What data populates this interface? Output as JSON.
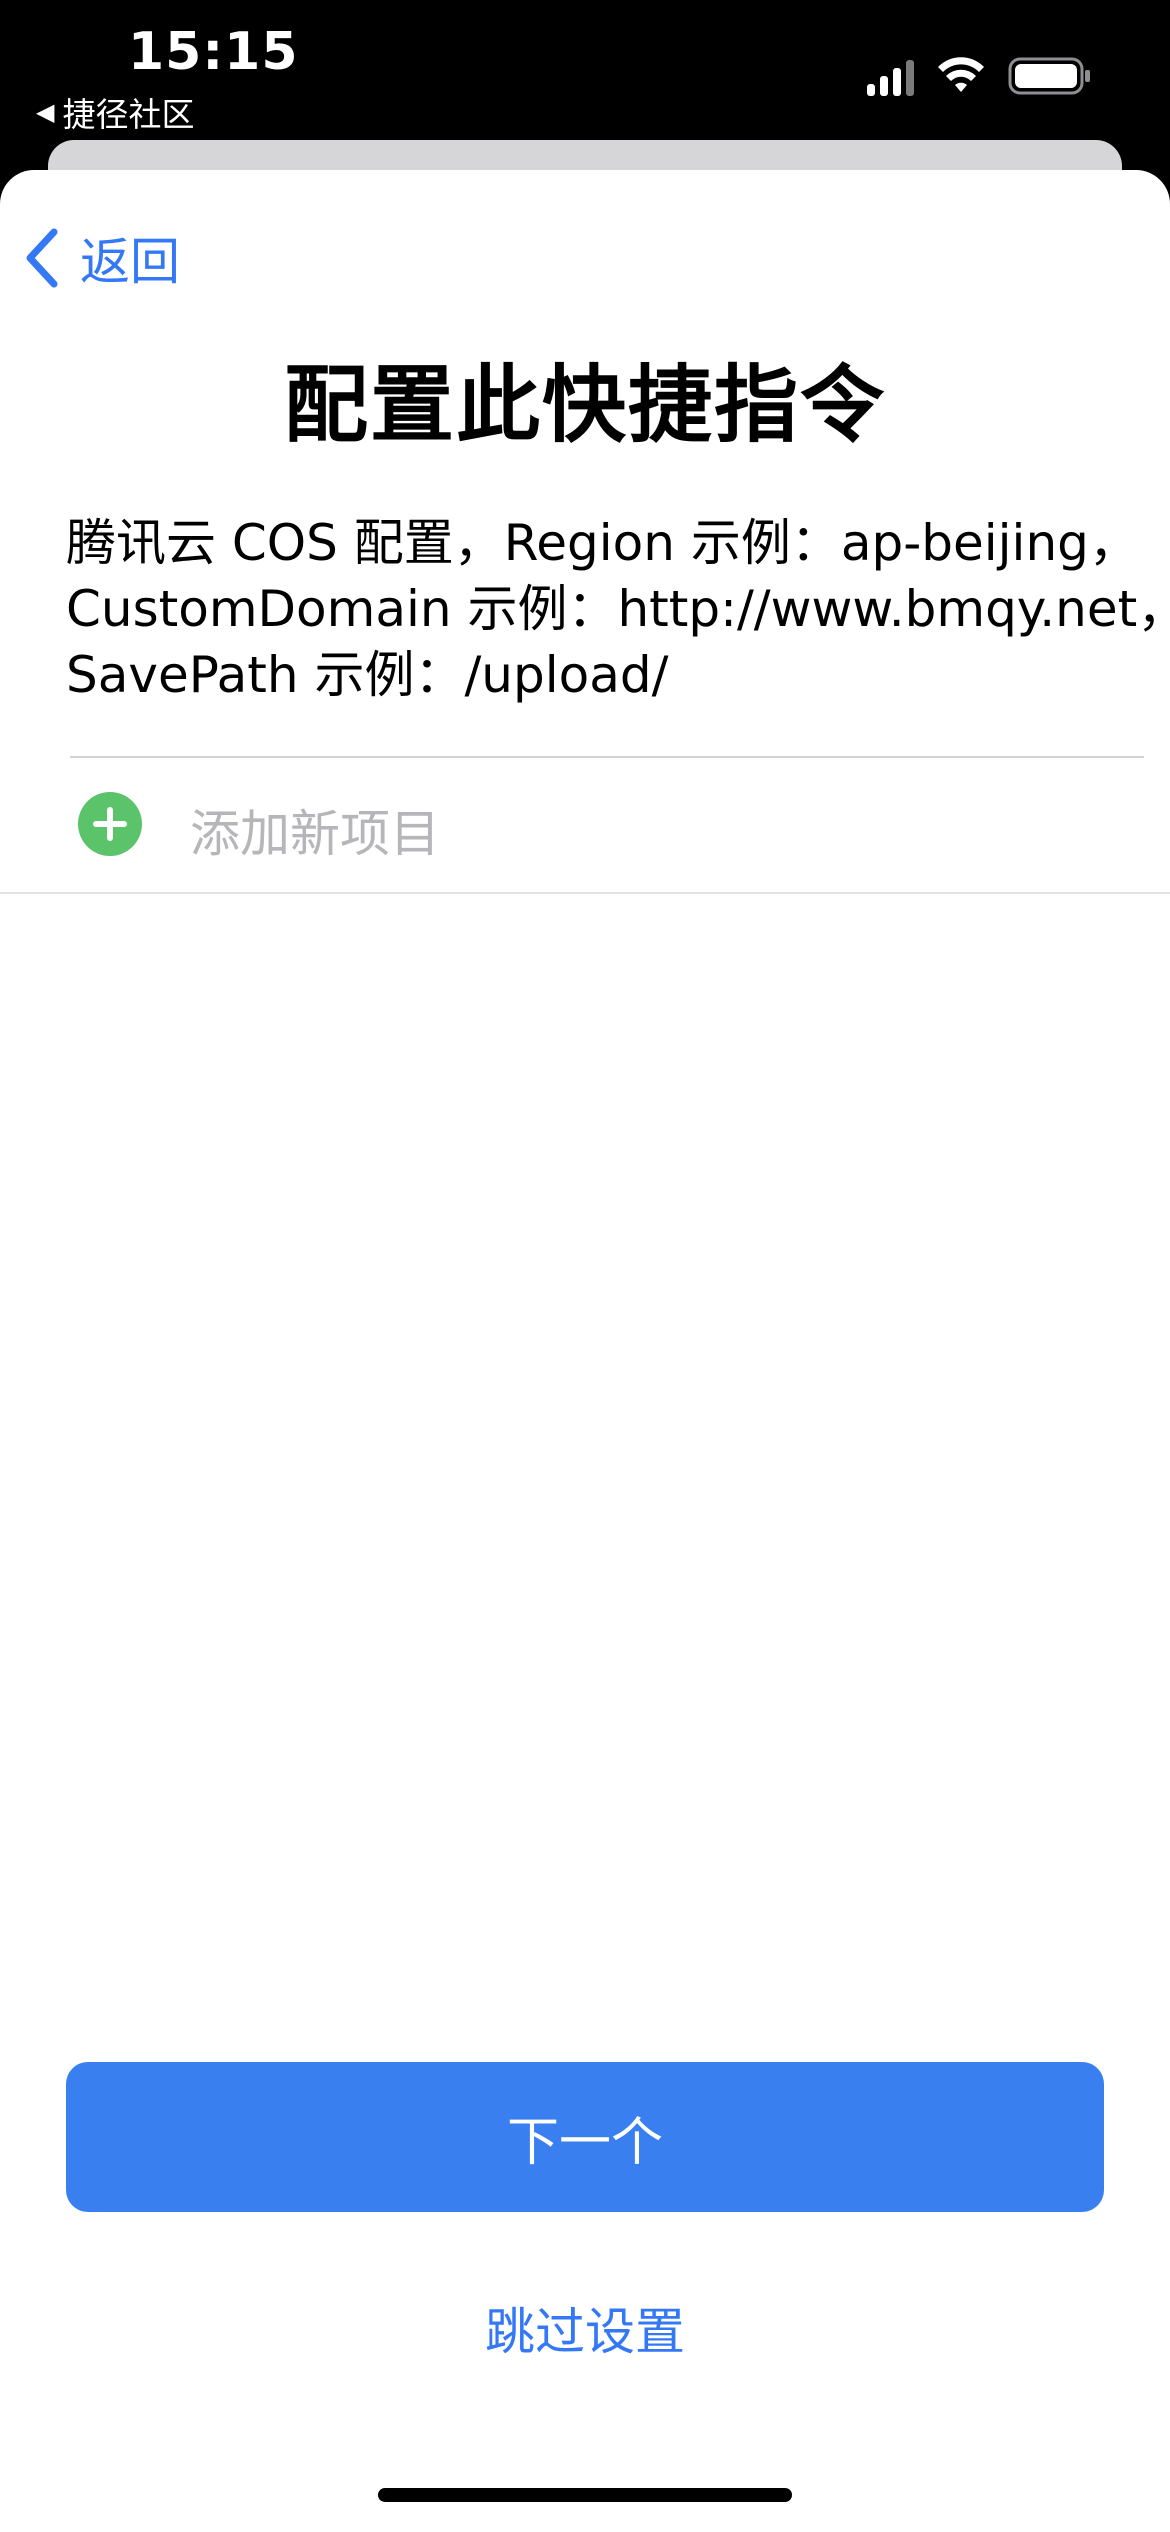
{
  "status_bar": {
    "time": "15:15",
    "back_app_label": "捷径社区",
    "back_arrow_glyph": "◀"
  },
  "nav": {
    "back_label": "返回"
  },
  "page": {
    "title": "配置此快捷指令",
    "description_lines": [
      "腾讯云 COS 配置，Region 示例：ap-beijing，",
      "CustomDomain 示例：http://www.bmqy.net，",
      "SavePath 示例：/upload/"
    ]
  },
  "list": {
    "add_item_label": "添加新项目"
  },
  "actions": {
    "next_label": "下一个",
    "skip_label": "跳过设置"
  },
  "colors": {
    "accent": "#3478f6",
    "primary_button": "#3a7ff0",
    "add_icon": "#5bc36a"
  }
}
